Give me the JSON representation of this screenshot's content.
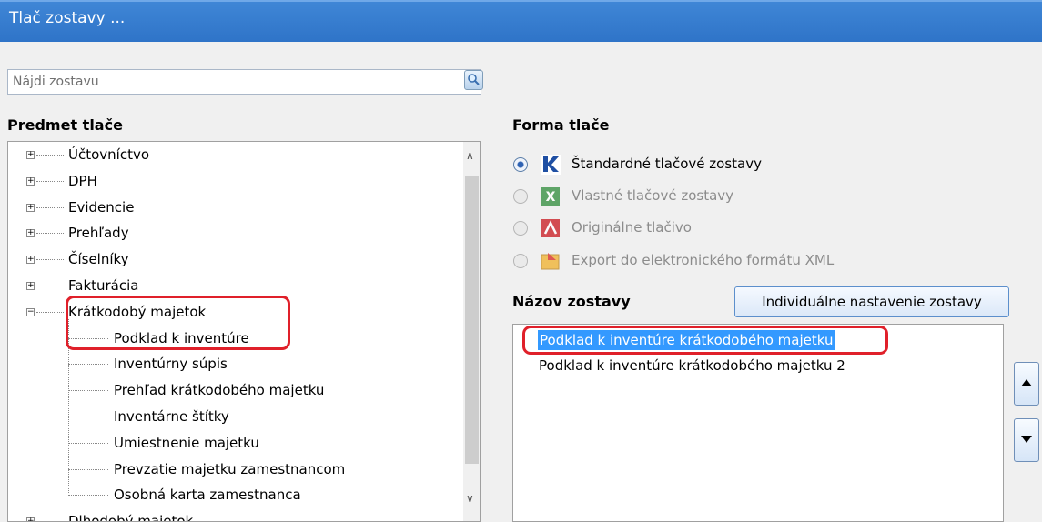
{
  "window": {
    "title": "Tlač zostavy ..."
  },
  "search": {
    "placeholder": "Nájdi zostavu",
    "button_icon": "search-icon"
  },
  "left": {
    "label": "Predmet tlače",
    "tree": [
      {
        "label": "Účtovníctvo",
        "level": 0,
        "expander": "+"
      },
      {
        "label": "DPH",
        "level": 0,
        "expander": "+"
      },
      {
        "label": "Evidencie",
        "level": 0,
        "expander": "+"
      },
      {
        "label": "Prehľady",
        "level": 0,
        "expander": "+"
      },
      {
        "label": "Číselníky",
        "level": 0,
        "expander": "+"
      },
      {
        "label": "Fakturácia",
        "level": 0,
        "expander": "+"
      },
      {
        "label": "Krátkodobý majetok",
        "level": 0,
        "expander": "−"
      },
      {
        "label": "Podklad k inventúre",
        "level": 1,
        "expander": ""
      },
      {
        "label": "Inventúrny súpis",
        "level": 1,
        "expander": ""
      },
      {
        "label": "Prehľad krátkodobého majetku",
        "level": 1,
        "expander": ""
      },
      {
        "label": "Inventárne štítky",
        "level": 1,
        "expander": ""
      },
      {
        "label": "Umiestnenie majetku",
        "level": 1,
        "expander": ""
      },
      {
        "label": "Prevzatie majetku zamestnancom",
        "level": 1,
        "expander": ""
      },
      {
        "label": "Osobná karta zamestnanca",
        "level": 1,
        "expander": ""
      },
      {
        "label": "Dlhodobý majetok",
        "level": 0,
        "expander": "+"
      }
    ]
  },
  "right": {
    "forma_label": "Forma tlače",
    "options": [
      {
        "label": "Štandardné tlačové zostavy",
        "selected": true,
        "enabled": true,
        "icon": "kros-icon"
      },
      {
        "label": "Vlastné tlačové zostavy",
        "selected": false,
        "enabled": false,
        "icon": "excel-icon"
      },
      {
        "label": "Originálne tlačivo",
        "selected": false,
        "enabled": false,
        "icon": "pdf-icon"
      },
      {
        "label": "Export do elektronického formátu XML",
        "selected": false,
        "enabled": false,
        "icon": "xml-export-icon"
      }
    ],
    "nazov_label": "Názov zostavy",
    "individual_button": "Individuálne nastavenie zostavy",
    "reports": [
      {
        "label": "Podklad k inventúre krátkodobého majetku",
        "selected": true
      },
      {
        "label": "Podklad k inventúre krátkodobého majetku 2",
        "selected": false
      }
    ]
  },
  "colors": {
    "titlebar": "#2f74c8",
    "selection": "#3399ff",
    "highlight": "#e0202a"
  }
}
